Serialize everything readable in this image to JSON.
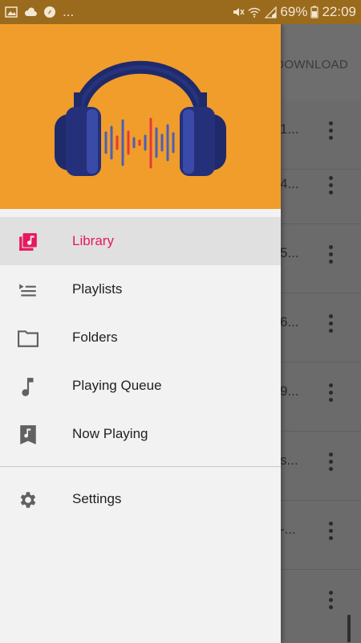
{
  "status_bar": {
    "ellipsis": "...",
    "battery": "69%",
    "time": "22:09"
  },
  "background": {
    "download_label": "DOWNLOAD",
    "rows": [
      "1...",
      "4...",
      "5...",
      "6...",
      "9...",
      "s...",
      "-...",
      ""
    ]
  },
  "drawer": {
    "items": [
      {
        "label": "Library",
        "icon": "library-music-icon",
        "active": true
      },
      {
        "label": "Playlists",
        "icon": "playlist-icon",
        "active": false
      },
      {
        "label": "Folders",
        "icon": "folder-icon",
        "active": false
      },
      {
        "label": "Playing Queue",
        "icon": "music-note-icon",
        "active": false
      },
      {
        "label": "Now Playing",
        "icon": "bookmark-music-icon",
        "active": false
      }
    ],
    "settings": {
      "label": "Settings",
      "icon": "gear-icon"
    }
  },
  "colors": {
    "header": "#f09d2c",
    "accent": "#e6185f",
    "headphones": "#1f2a6a"
  }
}
